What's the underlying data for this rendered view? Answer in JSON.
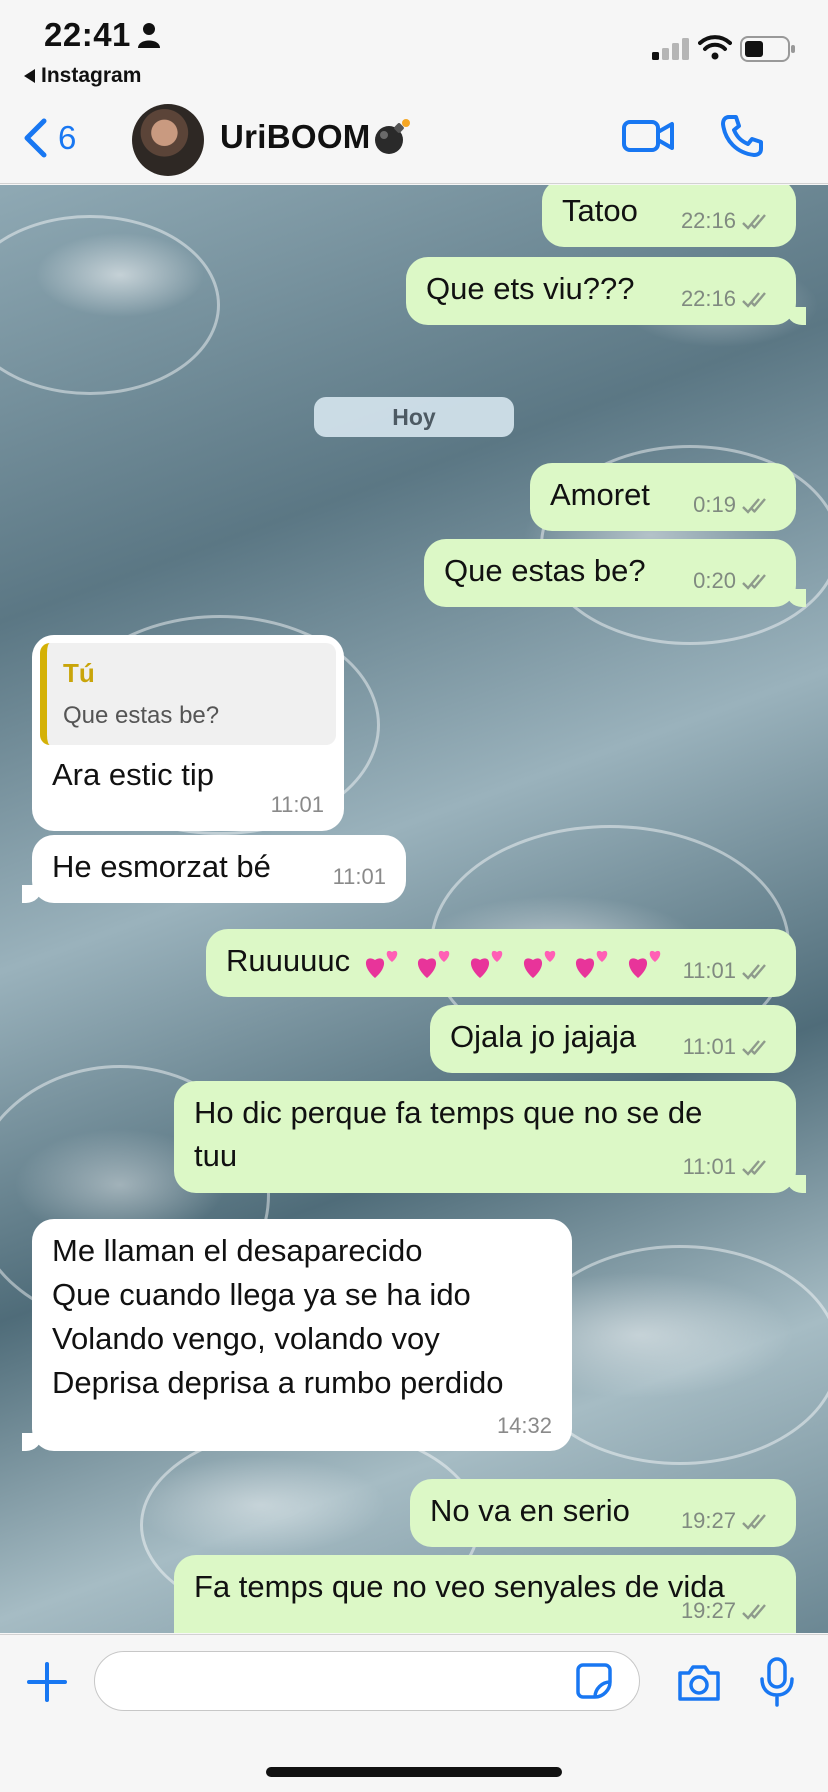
{
  "status_bar": {
    "time": "22:41",
    "back_app": "Instagram"
  },
  "header": {
    "back_count": "6",
    "contact_name": "UriBOOM"
  },
  "colors": {
    "accent": "#1877f2",
    "outgoing": "#dcf8c6",
    "incoming": "#ffffff",
    "quote_accent": "#d4b106"
  },
  "day_separator": "Hoy",
  "messages": [
    {
      "dir": "out",
      "text": "Tatoo",
      "time": "22:16"
    },
    {
      "dir": "out",
      "text": "Que ets viu???",
      "time": "22:16"
    },
    {
      "dir": "out",
      "text": "Amoret",
      "time": "0:19"
    },
    {
      "dir": "out",
      "text": "Que estas be?",
      "time": "0:20"
    },
    {
      "dir": "in",
      "quote_author": "Tú",
      "quote_text": "Que estas be?",
      "text": "Ara estic tip",
      "time": "11:01"
    },
    {
      "dir": "in",
      "text": "He esmorzat bé",
      "time": "11:01"
    },
    {
      "dir": "out",
      "text": "Ruuuuuc",
      "time": "11:01",
      "emoji": "two-hearts x6"
    },
    {
      "dir": "out",
      "text": "Ojala jo jajaja",
      "time": "11:01"
    },
    {
      "dir": "out",
      "text": "Ho dic perque fa temps que no se de\ntuu",
      "time": "11:01"
    },
    {
      "dir": "in",
      "text": "Me llaman el desaparecido\nQue cuando llega ya se ha ido\nVolando vengo, volando voy\nDeprisa deprisa a rumbo perdido",
      "time": "14:32"
    },
    {
      "dir": "out",
      "text": "No va en serio",
      "time": "19:27"
    },
    {
      "dir": "out",
      "text": "Fa temps que no veo senyales de vida",
      "time": "19:27"
    }
  ],
  "icons": [
    "person-icon",
    "signal-icon",
    "wifi-icon",
    "battery-icon",
    "back-chevron-icon",
    "video-call-icon",
    "phone-icon",
    "bomb-icon",
    "plus-icon",
    "sticker-icon",
    "camera-icon",
    "microphone-icon",
    "read-receipt-icon",
    "two-hearts-icon"
  ]
}
